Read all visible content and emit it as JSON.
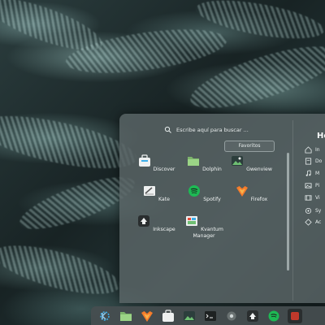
{
  "search": {
    "placeholder": "Escribe aquí para buscar ..."
  },
  "tabs": {
    "favorites_label": "Favoritos"
  },
  "apps": [
    {
      "label": "Discover",
      "icon": "discover-icon"
    },
    {
      "label": "Dolphin",
      "icon": "folder-icon"
    },
    {
      "label": "Gwenview",
      "icon": "image-viewer-icon"
    },
    {
      "label": "Kate",
      "icon": "text-editor-icon"
    },
    {
      "label": "Spotify",
      "icon": "spotify-icon"
    },
    {
      "label": "Firefox",
      "icon": "firefox-icon"
    },
    {
      "label": "Inkscape",
      "icon": "inkscape-icon"
    },
    {
      "label": "Kvantum Manager",
      "icon": "kvantum-icon"
    }
  ],
  "sidebar": {
    "title": "Ho",
    "items": [
      {
        "label": "In",
        "icon": "home-icon"
      },
      {
        "label": "Do",
        "icon": "documents-icon"
      },
      {
        "label": "M",
        "icon": "music-icon"
      },
      {
        "label": "Pi",
        "icon": "pictures-icon"
      },
      {
        "label": "Vi",
        "icon": "videos-icon"
      },
      {
        "label": "Sy",
        "icon": "system-icon"
      },
      {
        "label": "Ac",
        "icon": "accessories-icon"
      }
    ]
  },
  "taskbar": {
    "items": [
      "kde-launcher-icon",
      "folder-icon",
      "firefox-icon",
      "discover-icon",
      "image-viewer-icon",
      "terminal-icon",
      "settings-icon",
      "inkscape-icon",
      "spotify-icon",
      "app-icon"
    ]
  }
}
